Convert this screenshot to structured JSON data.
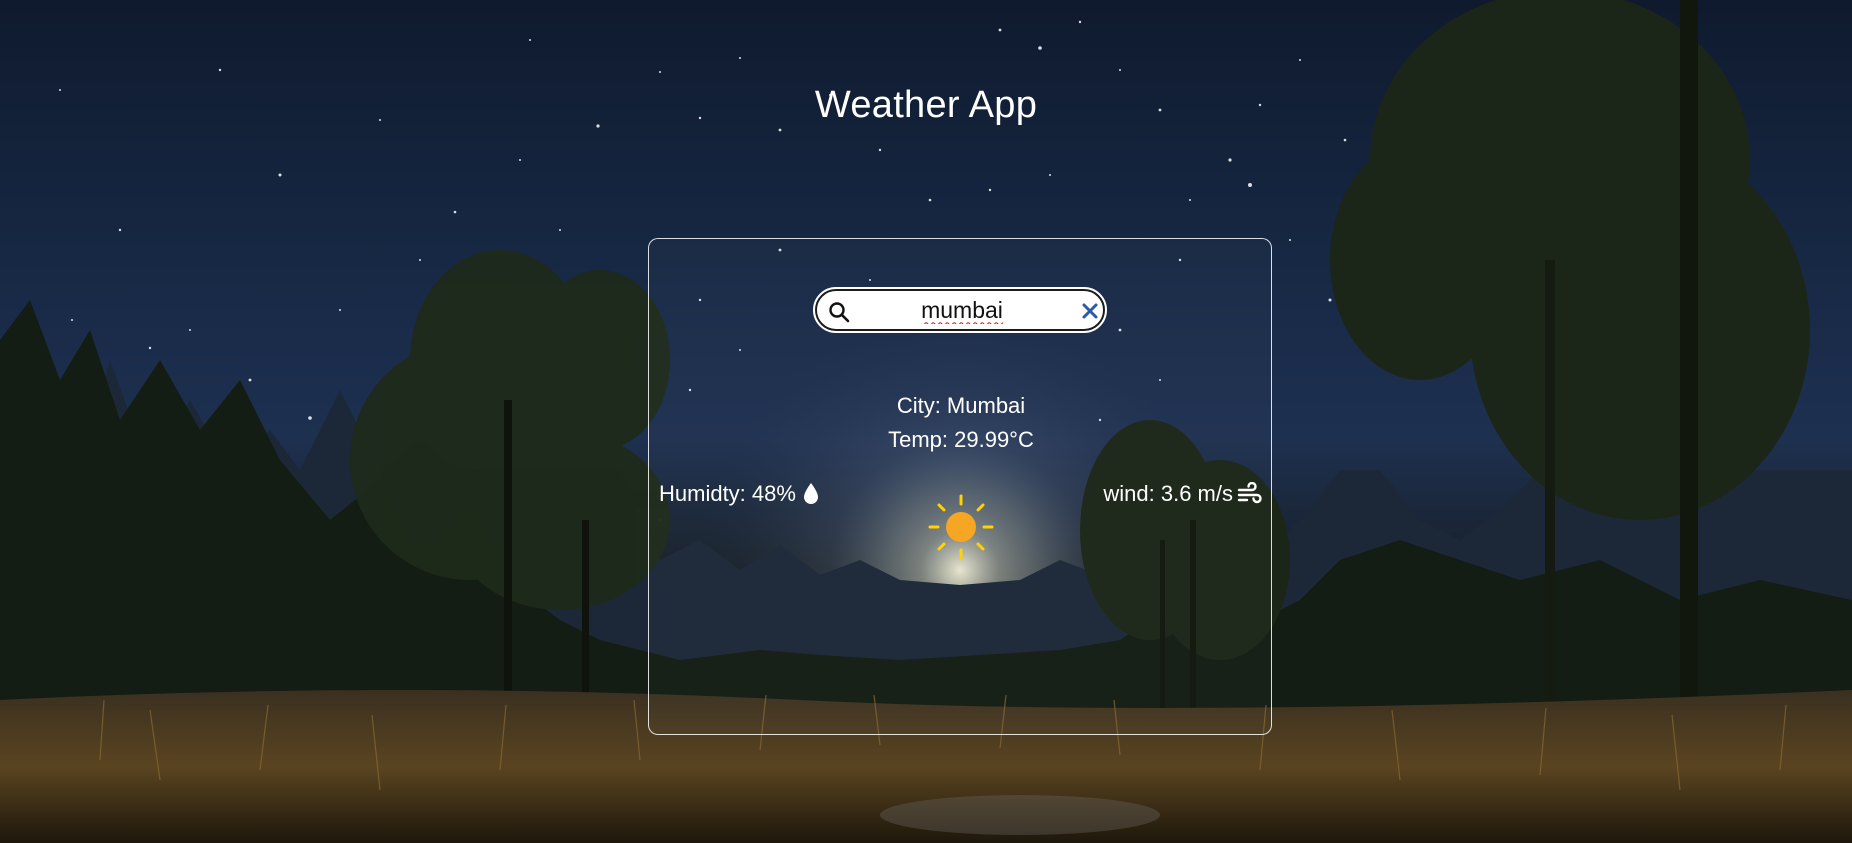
{
  "app": {
    "title": "Weather App"
  },
  "search": {
    "value": "mumbai",
    "placeholder": ""
  },
  "weather": {
    "city_text": "City: Mumbai",
    "temp_text": "Temp: 29.99°C",
    "humidity_text": "Humidty: 48%",
    "wind_text": "wind: 3.6 m/s",
    "condition_icon": "sun-icon",
    "humidity_icon": "droplet-icon",
    "wind_icon": "wind-icon"
  },
  "colors": {
    "sun": "#f5a623",
    "sun_rays": "#ffd200",
    "clear_icon": "#2d5aa8",
    "text": "#ffffff"
  }
}
